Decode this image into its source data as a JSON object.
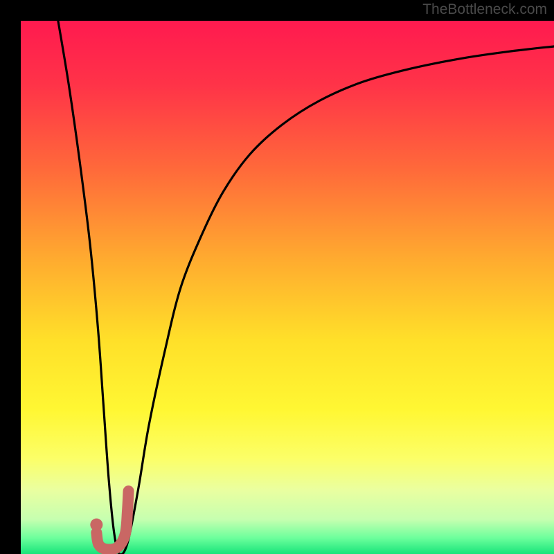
{
  "attribution": "TheBottleneck.com",
  "colors": {
    "frame": "#000000",
    "curve": "#000000",
    "marker_fill": "#c96764",
    "marker_stroke": "#c96764",
    "gradient_stops": [
      {
        "offset": 0.0,
        "color": "#ff1a4f"
      },
      {
        "offset": 0.12,
        "color": "#ff3348"
      },
      {
        "offset": 0.28,
        "color": "#ff6a3a"
      },
      {
        "offset": 0.45,
        "color": "#ffac2f"
      },
      {
        "offset": 0.6,
        "color": "#ffe029"
      },
      {
        "offset": 0.73,
        "color": "#fff733"
      },
      {
        "offset": 0.82,
        "color": "#fcff67"
      },
      {
        "offset": 0.88,
        "color": "#eaffa0"
      },
      {
        "offset": 0.935,
        "color": "#c6ffb0"
      },
      {
        "offset": 0.97,
        "color": "#6cff9c"
      },
      {
        "offset": 1.0,
        "color": "#18e47a"
      }
    ]
  },
  "chart_data": {
    "type": "line",
    "title": "",
    "xlabel": "",
    "ylabel": "",
    "xlim": [
      0,
      100
    ],
    "ylim": [
      0,
      100
    ],
    "grid": false,
    "legend": false,
    "series": [
      {
        "name": "bottleneck-curve",
        "x": [
          7,
          9,
          11,
          13,
          14.5,
          15.5,
          16.5,
          17.5,
          18.5,
          20,
          22,
          24,
          27,
          30,
          34,
          38,
          43,
          49,
          56,
          64,
          73,
          83,
          92,
          100
        ],
        "y": [
          100,
          88,
          74,
          58,
          42,
          28,
          14,
          4,
          0,
          2,
          12,
          24,
          38,
          50,
          60,
          68,
          75,
          80.5,
          85,
          88.5,
          91,
          93,
          94.3,
          95.2
        ]
      }
    ],
    "marker": {
      "name": "j-marker",
      "dot": {
        "x": 14.2,
        "y": 5.5
      },
      "hook": [
        {
          "x": 14.2,
          "y": 4.0
        },
        {
          "x": 14.6,
          "y": 1.8
        },
        {
          "x": 16.0,
          "y": 0.9
        },
        {
          "x": 18.2,
          "y": 1.3
        },
        {
          "x": 19.6,
          "y": 3.8
        },
        {
          "x": 20.0,
          "y": 8.0
        },
        {
          "x": 20.2,
          "y": 11.8
        }
      ]
    }
  }
}
